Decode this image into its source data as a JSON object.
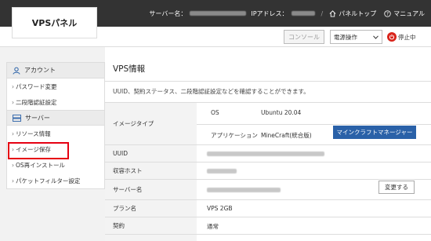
{
  "header": {
    "logo": "VPSパネル",
    "server_label": "サーバー名：",
    "ip_label": "IPアドレス：",
    "panel_top": "パネルトップ",
    "manual": "マニュアル"
  },
  "toolbar": {
    "console": "コンソール",
    "power_select": "電源操作",
    "status": "停止中"
  },
  "sidebar": {
    "account_heading": "アカウント",
    "account_items": [
      "パスワード変更",
      "二段階認証設定"
    ],
    "server_heading": "サーバー",
    "server_items": [
      "リソース情報",
      "イメージ保存",
      "OS再インストール",
      "パケットフィルター設定"
    ]
  },
  "main": {
    "title": "VPS情報",
    "description": "UUID、契約ステータス、二段階認証設定などを確認することができます。",
    "image_type": {
      "label": "イメージタイプ",
      "os_label": "OS",
      "os_value": "Ubuntu 20.04",
      "app_label": "アプリケーション",
      "app_value": "MineCraft(統合版)",
      "button": "マインクラフトマネージャー"
    },
    "uuid_label": "UUID",
    "host_label": "収容ホスト",
    "server_name_label": "サーバー名",
    "change_button": "変更する",
    "plan_label": "プラン名",
    "plan_value": "VPS 2GB",
    "contract_label": "契約",
    "contract_value": "通常"
  }
}
